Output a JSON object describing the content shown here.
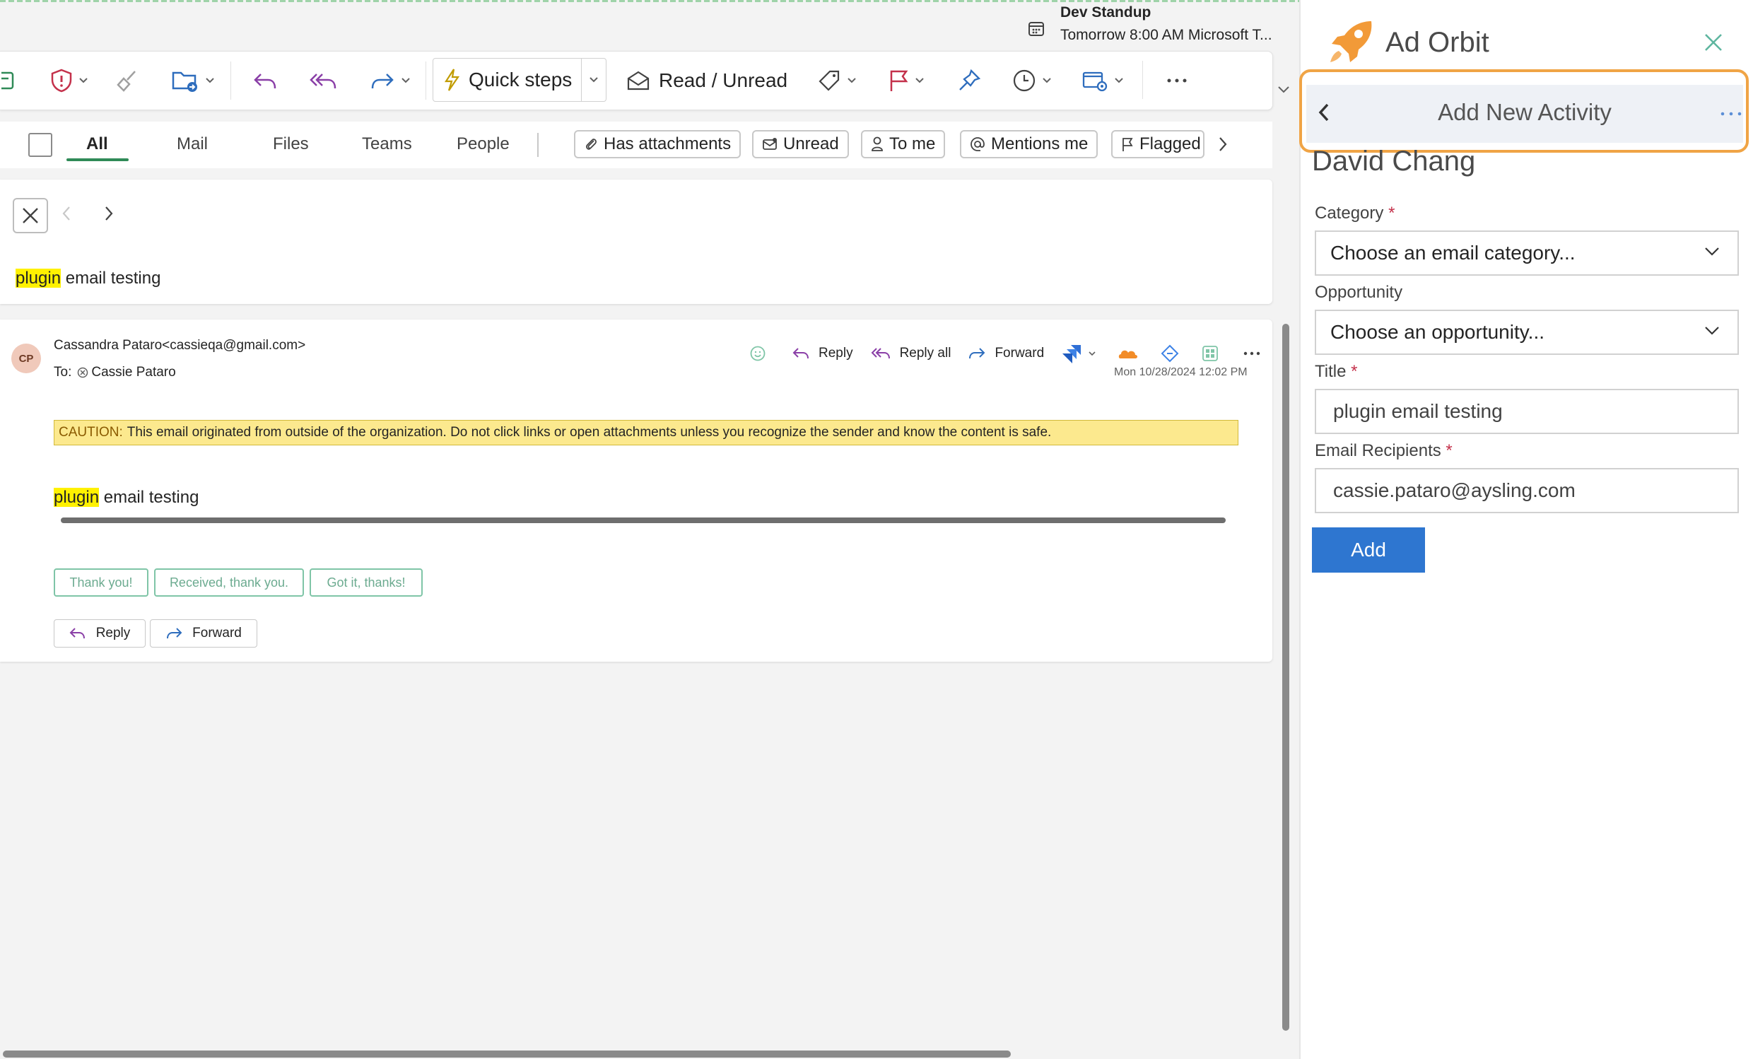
{
  "reminder": {
    "title": "Dev Standup",
    "detail": "Tomorrow 8:00 AM Microsoft T..."
  },
  "ribbon": {
    "quick_steps_label": "Quick steps",
    "read_unread_label": "Read / Unread"
  },
  "filters": {
    "tabs": [
      "All",
      "Mail",
      "Files",
      "Teams",
      "People"
    ],
    "pills": [
      "Has attachments",
      "Unread",
      "To me",
      "Mentions me",
      "Flagged"
    ]
  },
  "subject": {
    "highlight": "plugin",
    "rest": " email testing"
  },
  "message": {
    "avatar_initials": "CP",
    "sender": "Cassandra Pataro<cassieqa@gmail.com>",
    "to_label": "To:",
    "to_name": "Cassie Pataro",
    "actions": {
      "reply": "Reply",
      "reply_all": "Reply all",
      "forward": "Forward"
    },
    "date": "Mon 10/28/2024 12:02 PM",
    "caution_label": "CAUTION:",
    "caution_text": "This email originated from outside of the organization. Do not click links or open attachments unless you recognize the sender and know the content is safe.",
    "body_highlight": "plugin",
    "body_rest": " email testing",
    "suggested_replies": [
      "Thank you!",
      "Received, thank you.",
      "Got it, thanks!"
    ],
    "footer_reply": "Reply",
    "footer_forward": "Forward"
  },
  "addin": {
    "app_name": "Ad Orbit",
    "nav_title": "Add New Activity",
    "contact_name": "David Chang",
    "category": {
      "label": "Category",
      "required_mark": "*",
      "value": "Choose an email category..."
    },
    "opportunity": {
      "label": "Opportunity",
      "value": "Choose an opportunity..."
    },
    "title_field": {
      "label": "Title",
      "required_mark": "*",
      "value": "plugin email testing"
    },
    "recipients": {
      "label": "Email Recipients",
      "required_mark": "*",
      "value": "cassie.pataro@aysling.com"
    },
    "add_label": "Add"
  },
  "colors": {
    "accent_green": "#2f8a57",
    "highlight_yellow": "#fff100",
    "caution_bg": "#fce98e",
    "focus_orange": "#f0a445",
    "add_button_blue": "#2e76d0",
    "flag_red": "#c4314b",
    "reply_purple": "#8a3fa7",
    "forward_blue": "#2e6dbd"
  }
}
